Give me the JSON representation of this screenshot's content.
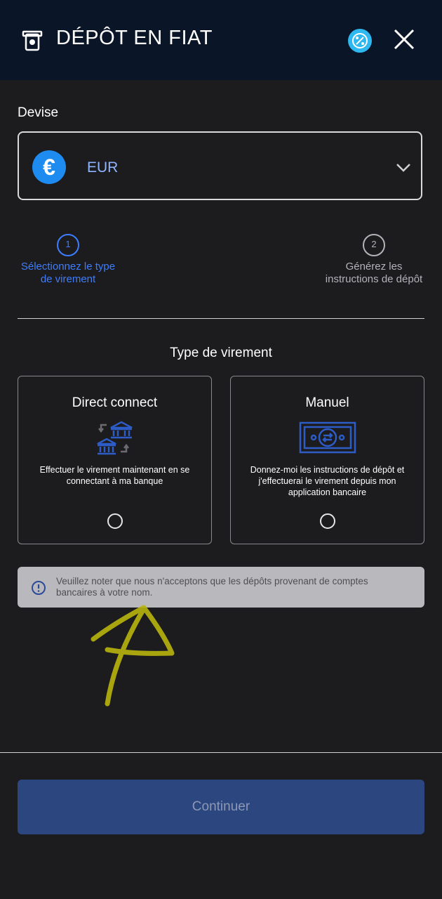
{
  "header": {
    "title": "DÉPÔT EN FIAT",
    "icon": "deposit-icon",
    "promo_icon": "percent-badge-icon",
    "close_icon": "close-icon"
  },
  "currency": {
    "label": "Devise",
    "value": "EUR",
    "symbol": "€",
    "icon": "euro-icon"
  },
  "steps": [
    {
      "number": "1",
      "label": "Sélectionnez le type de virement",
      "active": true
    },
    {
      "number": "2",
      "label": "Générez les instructions de dépôt",
      "active": false
    }
  ],
  "transfer_type": {
    "title": "Type de virement",
    "options": [
      {
        "title": "Direct connect",
        "description": "Effectuer le virement maintenant en se connectant à ma banque",
        "icon": "bank-transfer-icon"
      },
      {
        "title": "Manuel",
        "description": "Donnez-moi les instructions de dépôt et j'effectuerai le virement depuis mon application bancaire",
        "icon": "banknote-icon"
      }
    ]
  },
  "notice": {
    "text": "Veuillez noter que nous n'acceptons que les dépôts provenant de comptes bancaires à votre nom.",
    "icon": "info-icon"
  },
  "footer": {
    "continue_label": "Continuer"
  },
  "colors": {
    "header_bg": "#0a1628",
    "background": "#1c1c1e",
    "accent": "#3d7dff",
    "button_bg": "#2c4680",
    "annotation": "#c9c21a"
  }
}
